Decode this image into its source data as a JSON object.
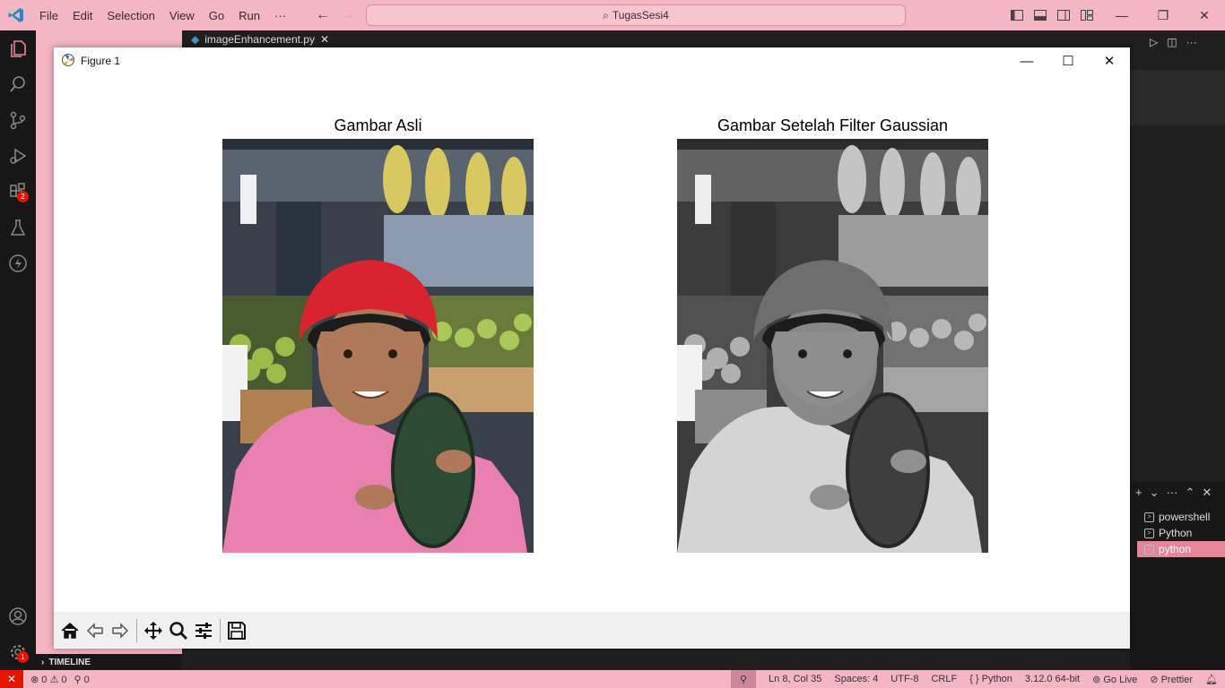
{
  "titlebar": {
    "menu": [
      "File",
      "Edit",
      "Selection",
      "View",
      "Go",
      "Run",
      "···"
    ],
    "search_text": "TugasSesi4"
  },
  "activity": {
    "extensions_badge": "2",
    "settings_badge": "1"
  },
  "editor": {
    "tab_label": "imageEnhancement.py"
  },
  "terminal": {
    "items": [
      "powershell",
      "Python",
      "python"
    ],
    "active_index": 2
  },
  "sidebar": {
    "timeline_label": "TIMELINE"
  },
  "statusbar": {
    "errors": "0",
    "warnings": "0",
    "ports": "0",
    "position": "Ln 8, Col 35",
    "spaces": "Spaces: 4",
    "encoding": "UTF-8",
    "eol": "CRLF",
    "language": "Python",
    "interpreter": "3.12.0 64-bit",
    "golive": "Go Live",
    "prettier": "Prettier"
  },
  "figure": {
    "window_title": "Figure 1",
    "left_title": "Gambar Asli",
    "right_title": "Gambar Setelah Filter Gaussian"
  },
  "colors": {
    "accent_pink": "#f4b5c4",
    "error_red": "#e51400",
    "helmet_red": "#d9232e",
    "jacket_pink": "#ee7fb0"
  }
}
